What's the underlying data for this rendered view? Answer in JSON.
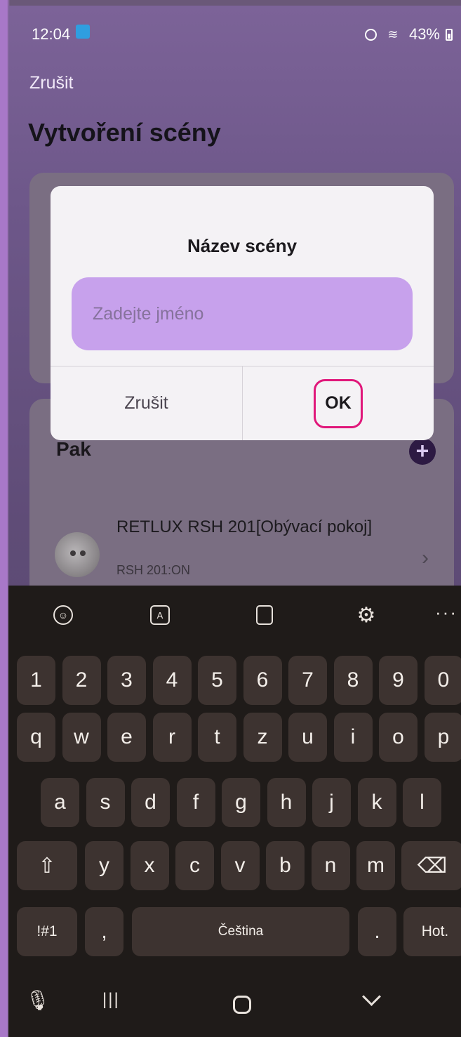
{
  "status_bar": {
    "time": "12:04",
    "battery": "43%"
  },
  "header": {
    "cancel": "Zrušit",
    "title": "Vytvoření scény"
  },
  "then_card": {
    "title": "Pak",
    "device": {
      "name": "RETLUX RSH 201[Obývací pokoj]",
      "subtitle": "RSH 201:ON"
    }
  },
  "dialog": {
    "title": "Název scény",
    "input_placeholder": "Zadejte jméno",
    "input_value": "",
    "cancel": "Zrušit",
    "ok": "OK"
  },
  "keyboard": {
    "toolbar_icons": [
      "emoji-icon",
      "translate-icon",
      "clipboard-icon",
      "gear-icon",
      "more-icon"
    ],
    "number_row": [
      "1",
      "2",
      "3",
      "4",
      "5",
      "6",
      "7",
      "8",
      "9",
      "0"
    ],
    "row_q": [
      "q",
      "w",
      "e",
      "r",
      "t",
      "z",
      "u",
      "i",
      "o",
      "p"
    ],
    "row_a": [
      "a",
      "s",
      "d",
      "f",
      "g",
      "h",
      "j",
      "k",
      "l"
    ],
    "row_y": [
      "y",
      "x",
      "c",
      "v",
      "b",
      "n",
      "m"
    ],
    "symbols": "!#1",
    "comma": ",",
    "space": "Čeština",
    "period": ".",
    "enter": "Hot."
  },
  "nav_bar": {
    "icons": [
      "microphone-icon",
      "recent-apps-icon",
      "home-icon",
      "back-icon"
    ]
  },
  "colors": {
    "accent": "#e0177a",
    "input_fill": "#c7a1ec",
    "plus_button": "#2d1a43"
  }
}
